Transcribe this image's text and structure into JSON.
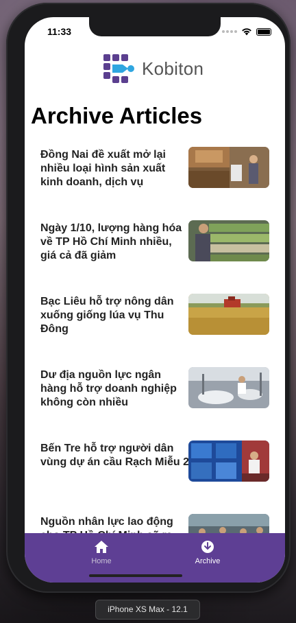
{
  "status_bar": {
    "time": "11:33"
  },
  "brand": {
    "name": "Kobiton"
  },
  "page": {
    "title": "Archive Articles"
  },
  "articles": [
    {
      "title": "Đồng Nai đề xuất mở lại nhiều loại hình sản xuất kinh doanh, dịch vụ",
      "thumb": "market-stall"
    },
    {
      "title": " Ngày 1/10, lượng hàng hóa về TP Hồ Chí Minh nhiều, giá cả đã giảm",
      "thumb": "vegetable-shelves"
    },
    {
      "title": " Bạc Liêu hỗ trợ nông dân xuống giống lúa vụ Thu Đông",
      "thumb": "rice-field-harvester"
    },
    {
      "title": " Dư địa nguồn lực ngân hàng hỗ trợ doanh nghiệp không còn nhiều",
      "thumb": "factory-workers"
    },
    {
      "title": " Bến Tre hỗ trợ người dân vùng dự án cầu Rạch Miễu 2",
      "thumb": "video-conference"
    },
    {
      "title": " Nguồn nhân lực lao động cho TP Hồ Chí Minh sẽ ra sao",
      "thumb": "street-crowd"
    }
  ],
  "tabbar": {
    "tabs": [
      {
        "label": "Home",
        "icon": "home-icon"
      },
      {
        "label": "Archive",
        "icon": "download-circle-icon"
      }
    ]
  },
  "simulator": {
    "device": "iPhone XS Max - 12.1"
  }
}
